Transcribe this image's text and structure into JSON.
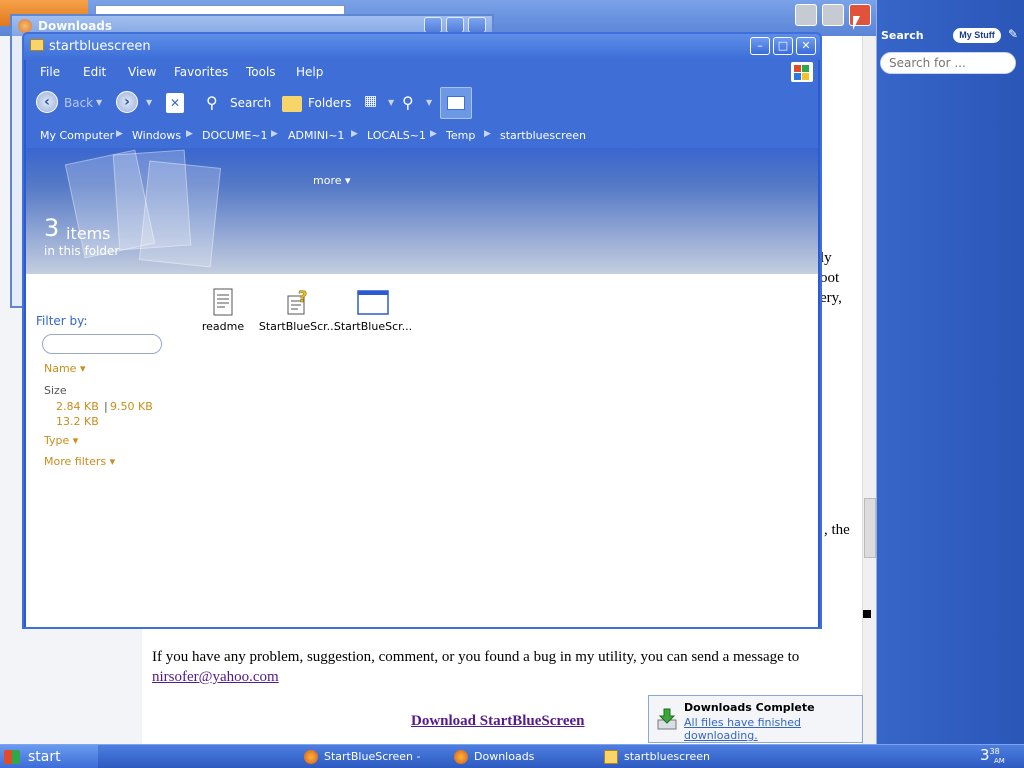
{
  "browser": {
    "page_contact_text": "If you have any problem, suggestion, comment, or you found a bug in my utility, you can send a message to",
    "page_email": "nirsofer@yahoo.com",
    "page_download_link": "Download StartBlueScreen",
    "page_fragment_1": "ly",
    "page_fragment_2": "oot",
    "page_fragment_3": "ery,",
    "page_fragment_4": ", the"
  },
  "sidebar": {
    "search_label": "Search",
    "my_stuff_label": "My Stuff",
    "search_placeholder": "Search for ..."
  },
  "downloads_window": {
    "title": "Downloads"
  },
  "explorer": {
    "title": "startbluescreen",
    "menu": [
      "File",
      "Edit",
      "View",
      "Favorites",
      "Tools",
      "Help"
    ],
    "toolbar": {
      "back_label": "Back",
      "search_label": "Search",
      "folders_label": "Folders"
    },
    "breadcrumb": [
      "My Computer",
      "Windows",
      "DOCUME~1",
      "ADMINI~1",
      "LOCALS~1",
      "Temp",
      "startbluescreen"
    ],
    "banner": {
      "more_label": "more",
      "count": "3",
      "items_label": "items",
      "subtitle": "in this folder"
    },
    "filter": {
      "label": "Filter by:",
      "name_label": "Name",
      "size_label": "Size",
      "size_values": [
        "2.84 KB",
        "9.50 KB",
        "13.2 KB"
      ],
      "size_separator": "|",
      "type_label": "Type",
      "more_filters_label": "More filters"
    },
    "files": [
      {
        "name": "readme",
        "icon": "text-document-icon"
      },
      {
        "name": "StartBlueScr...",
        "icon": "help-file-icon"
      },
      {
        "name": "StartBlueScr...",
        "icon": "application-window-icon"
      }
    ]
  },
  "notification": {
    "title": "Downloads Complete",
    "text": "All files have finished downloading."
  },
  "taskbar": {
    "start_label": "start",
    "tasks": [
      {
        "label": "StartBlueScreen - Initiat",
        "icon": "firefox-icon"
      },
      {
        "label": "Downloads",
        "icon": "firefox-icon"
      },
      {
        "label": "startbluescreen",
        "icon": "folder-icon"
      }
    ],
    "clock_hour": "3",
    "clock_min": "38",
    "clock_ampm": "AM"
  },
  "colors": {
    "xp_blue": "#3f6ed6",
    "filter_accent": "#c88d1c",
    "link_visited": "#551a8b"
  }
}
